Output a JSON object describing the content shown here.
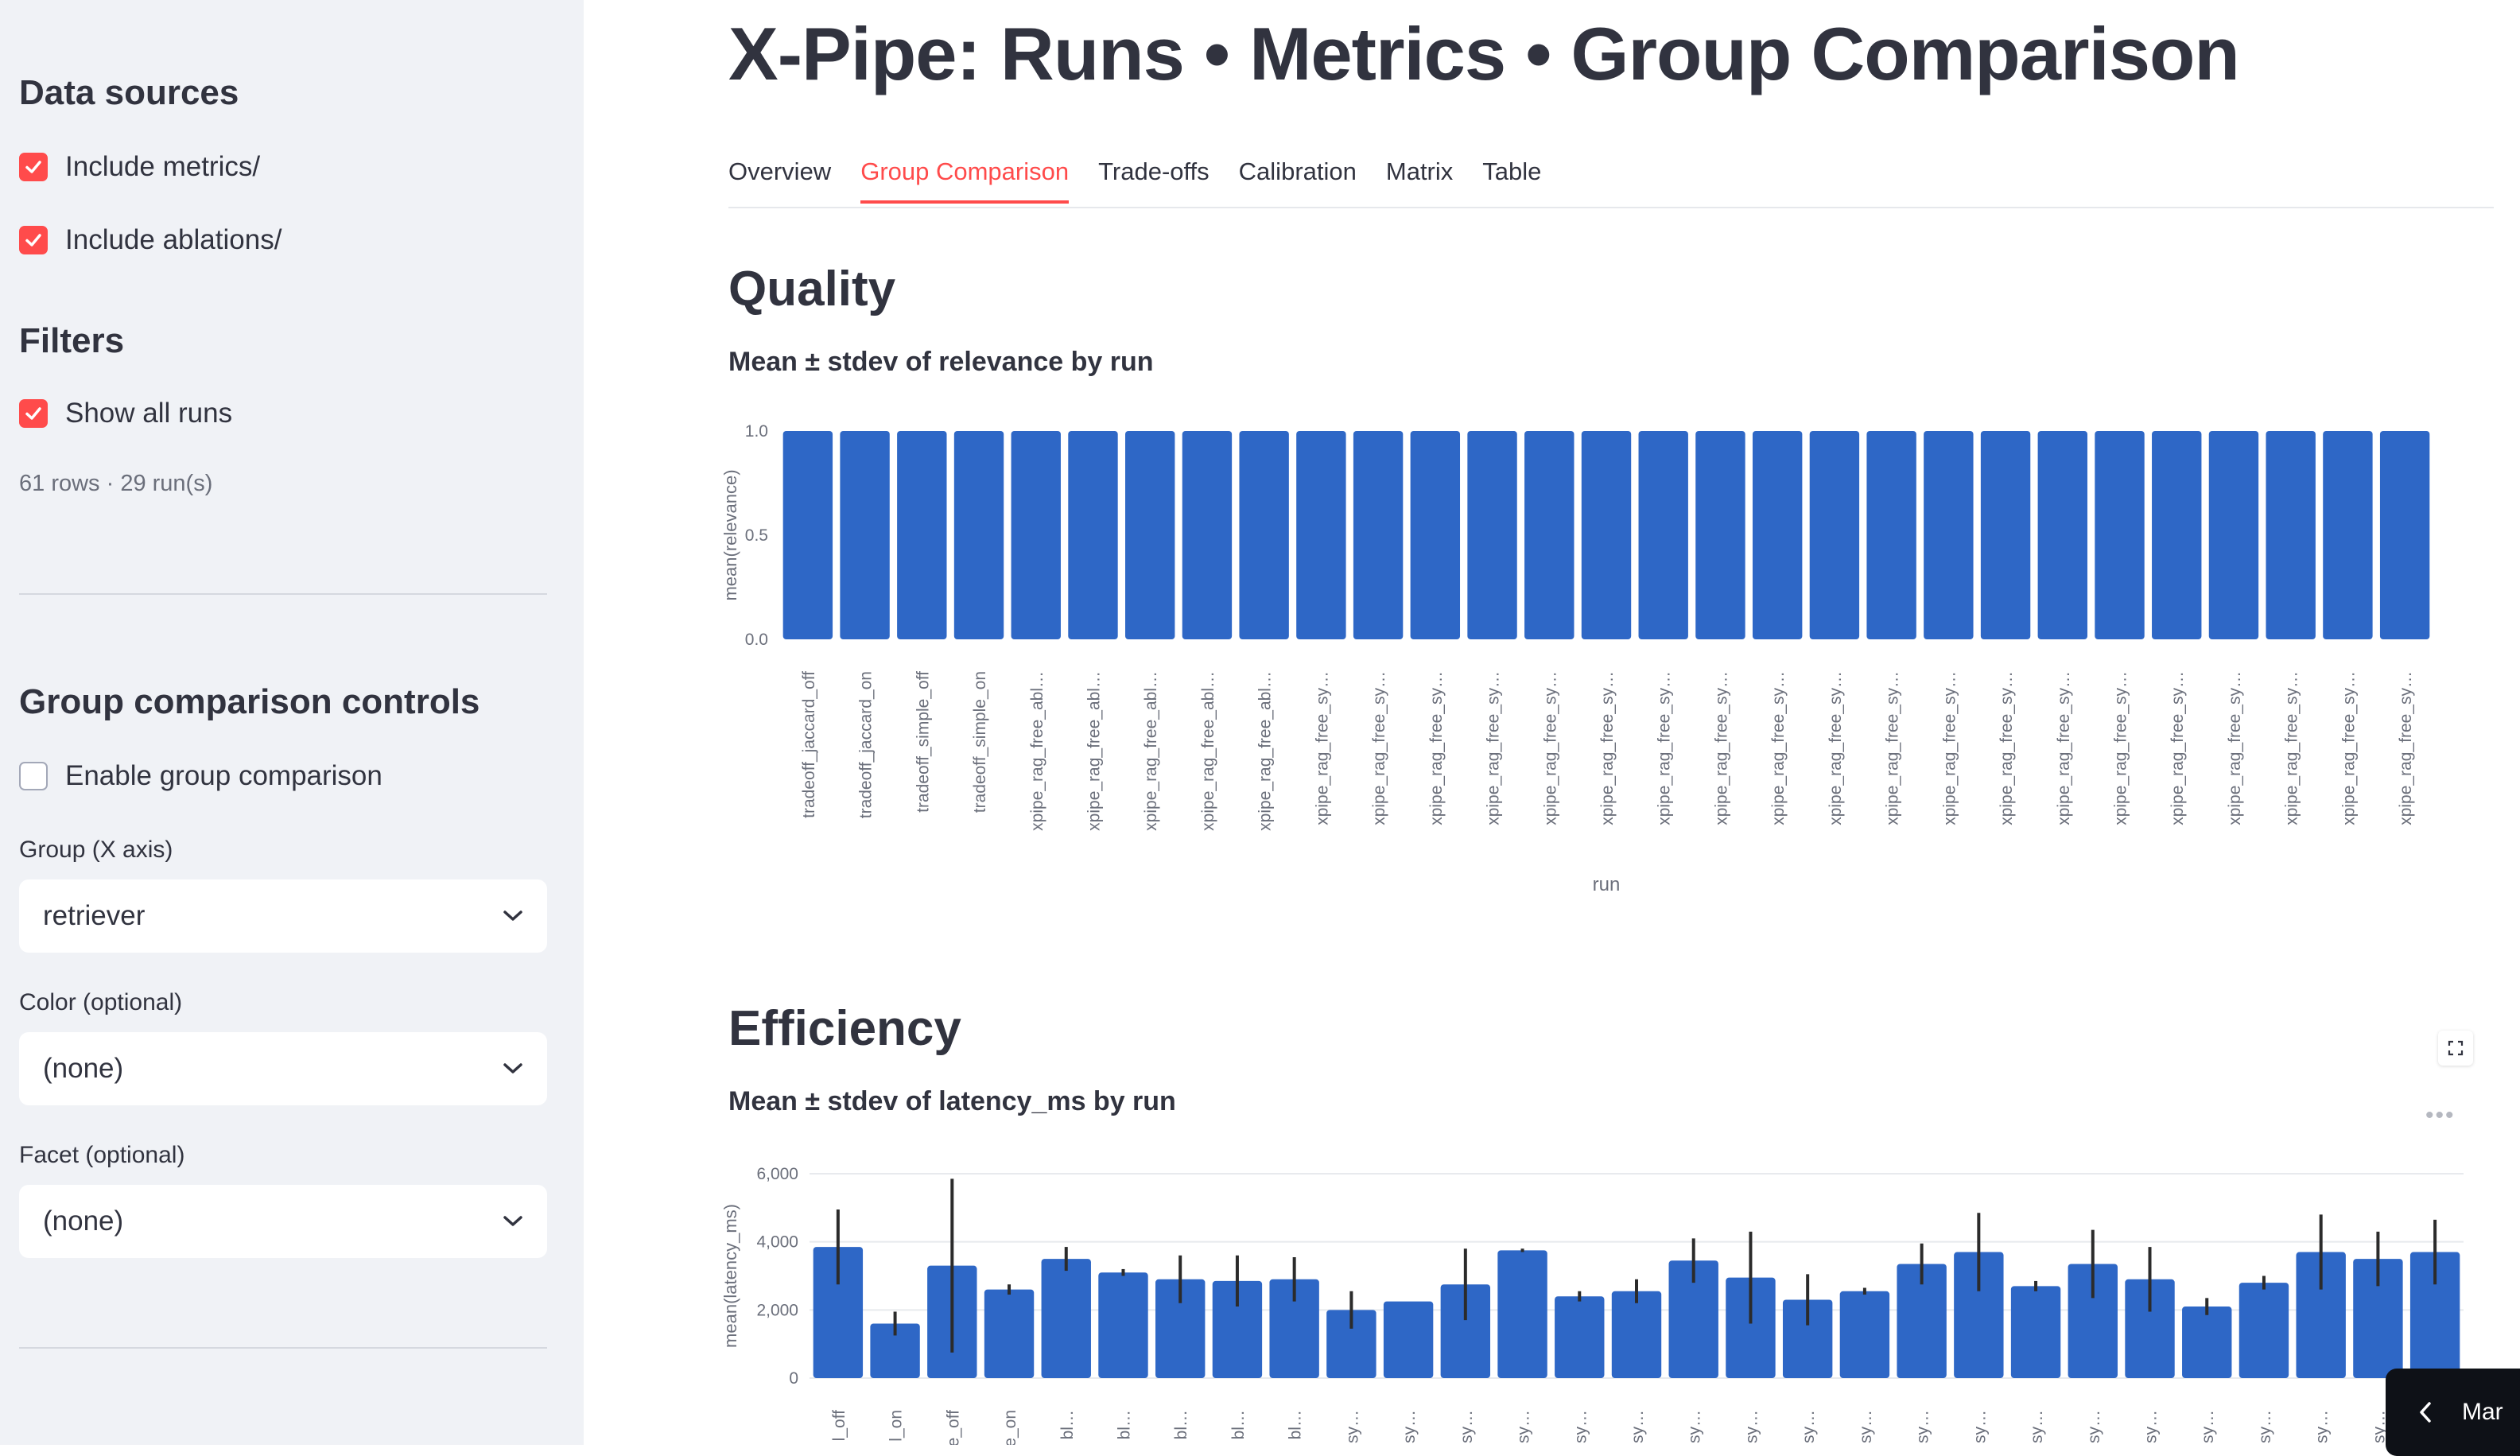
{
  "sidebar": {
    "data_sources_heading": "Data sources",
    "include_metrics": {
      "label": "Include metrics/",
      "checked": true
    },
    "include_ablations": {
      "label": "Include ablations/",
      "checked": true
    },
    "filters_heading": "Filters",
    "show_all_runs": {
      "label": "Show all runs",
      "checked": true
    },
    "row_count_caption": "61 rows · 29 run(s)",
    "group_heading": "Group comparison controls",
    "enable_group": {
      "label": "Enable group comparison",
      "checked": false
    },
    "group_x_label": "Group (X axis)",
    "group_x_value": "retriever",
    "color_label": "Color (optional)",
    "color_value": "(none)",
    "facet_label": "Facet (optional)",
    "facet_value": "(none)"
  },
  "main": {
    "title": "X-Pipe: Runs • Metrics • Group Comparison",
    "tabs": [
      {
        "label": "Overview",
        "active": false
      },
      {
        "label": "Group Comparison",
        "active": true
      },
      {
        "label": "Trade-offs",
        "active": false
      },
      {
        "label": "Calibration",
        "active": false
      },
      {
        "label": "Matrix",
        "active": false
      },
      {
        "label": "Table",
        "active": false
      }
    ],
    "quality_heading": "Quality",
    "quality_chart_title": "Mean ± stdev of relevance by run",
    "efficiency_heading": "Efficiency",
    "efficiency_chart_title": "Mean ± stdev of latency_ms by run",
    "toast_text": "Mar"
  },
  "colors": {
    "accent": "#ff4b4b",
    "bar": "#2e67c6",
    "sidebar_bg": "#f0f2f6"
  },
  "chart_data": [
    {
      "type": "bar",
      "title": "Mean ± stdev of relevance by run",
      "xlabel": "run",
      "ylabel": "mean(relevance)",
      "ylim": [
        0,
        1
      ],
      "yticks": [
        "0.0",
        "0.5",
        "1.0"
      ],
      "grid": false,
      "categories": [
        "tradeoff_jaccard_off",
        "tradeoff_jaccard_on",
        "tradeoff_simple_off",
        "tradeoff_simple_on",
        "xpipe_rag_free_abl…",
        "xpipe_rag_free_abl…",
        "xpipe_rag_free_abl…",
        "xpipe_rag_free_abl…",
        "xpipe_rag_free_abl…",
        "xpipe_rag_free_sy…",
        "xpipe_rag_free_sy…",
        "xpipe_rag_free_sy…",
        "xpipe_rag_free_sy…",
        "xpipe_rag_free_sy…",
        "xpipe_rag_free_sy…",
        "xpipe_rag_free_sy…",
        "xpipe_rag_free_sy…",
        "xpipe_rag_free_sy…",
        "xpipe_rag_free_sy…",
        "xpipe_rag_free_sy…",
        "xpipe_rag_free_sy…",
        "xpipe_rag_free_sy…",
        "xpipe_rag_free_sy…",
        "xpipe_rag_free_sy…",
        "xpipe_rag_free_sy…",
        "xpipe_rag_free_sy…",
        "xpipe_rag_free_sy…",
        "xpipe_rag_free_sy…",
        "xpipe_rag_free_sy…"
      ],
      "values": [
        1,
        1,
        1,
        1,
        1,
        1,
        1,
        1,
        1,
        1,
        1,
        1,
        1,
        1,
        1,
        1,
        1,
        1,
        1,
        1,
        1,
        1,
        1,
        1,
        1,
        1,
        1,
        1,
        1
      ]
    },
    {
      "type": "bar",
      "title": "Mean ± stdev of latency_ms by run",
      "ylabel": "mean(latency_ms)",
      "ylim": [
        0,
        6000
      ],
      "yticks": [
        "0",
        "2,000",
        "4,000",
        "6,000"
      ],
      "grid": true,
      "categories": [
        "l_off",
        "l_on",
        "e_off",
        "e_on",
        "bl…",
        "bl…",
        "bl…",
        "bl…",
        "bl…",
        "sy…",
        "sy…",
        "sy…",
        "sy…",
        "sy…",
        "sy…",
        "sy…",
        "sy…",
        "sy…",
        "sy…",
        "sy…",
        "sy…",
        "sy…",
        "sy…",
        "sy…",
        "sy…",
        "sy…",
        "sy…",
        "sy…",
        "sy…"
      ],
      "values": [
        3850,
        1600,
        3300,
        2600,
        3500,
        3100,
        2900,
        2850,
        2900,
        2000,
        2250,
        2750,
        3750,
        2400,
        2550,
        3450,
        2950,
        2300,
        2550,
        3350,
        3700,
        2700,
        3350,
        2900,
        2100,
        2800,
        3700,
        3500,
        3700
      ],
      "stdev": [
        1100,
        350,
        2550,
        150,
        350,
        100,
        700,
        750,
        650,
        550,
        0,
        1050,
        50,
        150,
        350,
        650,
        1350,
        750,
        100,
        600,
        1150,
        150,
        1000,
        950,
        250,
        200,
        1100,
        800,
        950
      ]
    }
  ]
}
